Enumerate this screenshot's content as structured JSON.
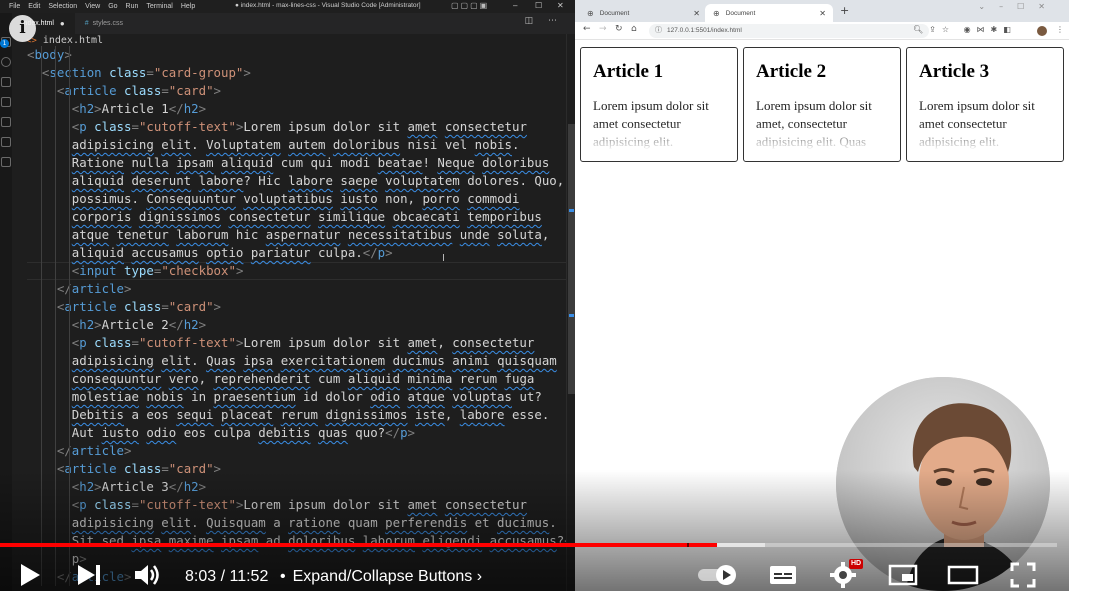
{
  "vscode": {
    "menu": [
      "File",
      "Edit",
      "Selection",
      "View",
      "Go",
      "Run",
      "Terminal",
      "Help"
    ],
    "window_title": "● index.html - max-lines-css - Visual Studio Code [Administrator]",
    "tabs": [
      {
        "label": "index.html",
        "modified": "●"
      },
      {
        "label": "styles.css",
        "icon": "#"
      }
    ],
    "breadcrumb": {
      "icon": "<>",
      "file": "index.html"
    },
    "badge": "1",
    "code_lines": [
      [
        "<body>"
      ],
      [
        "  <section class=\"card-group\">"
      ],
      [
        "    <article class=\"card\">"
      ],
      [
        "      <h2>Article 1</h2>"
      ],
      [
        "      <p class=\"cutoff-text\">Lorem ipsum dolor sit amet consectetur"
      ],
      [
        "      adipisicing elit. Voluptatem autem doloribus nisi vel nobis."
      ],
      [
        "      Ratione nulla ipsam aliquid cum qui modi beatae! Neque doloribus"
      ],
      [
        "      aliquid deserunt labore? Hic labore saepe voluptatem dolores. Quo,"
      ],
      [
        "      possimus. Consequuntur voluptatibus iusto non, porro commodi"
      ],
      [
        "      corporis dignissimos consectetur similique obcaecati temporibus"
      ],
      [
        "      atque tenetur laborum hic aspernatur necessitatibus unde soluta,"
      ],
      [
        "      aliquid accusamus optio pariatur culpa.</p>"
      ],
      [
        "      <input type=\"checkbox\">"
      ],
      [
        "    </article>"
      ],
      [
        "    <article class=\"card\">"
      ],
      [
        "      <h2>Article 2</h2>"
      ],
      [
        "      <p class=\"cutoff-text\">Lorem ipsum dolor sit amet, consectetur"
      ],
      [
        "      adipisicing elit. Quas ipsa exercitationem ducimus animi quisquam"
      ],
      [
        "      consequuntur vero, reprehenderit cum aliquid minima rerum fuga"
      ],
      [
        "      molestiae nobis in praesentium id dolor odio atque voluptas ut?"
      ],
      [
        "      Debitis a eos sequi placeat rerum dignissimos iste, labore esse."
      ],
      [
        "      Aut iusto odio eos culpa debitis quas quo?</p>"
      ],
      [
        "    </article>"
      ],
      [
        "    <article class=\"card\">"
      ],
      [
        "      <h2>Article 3</h2>"
      ],
      [
        "      <p class=\"cutoff-text\">Lorem ipsum dolor sit amet consectetur"
      ],
      [
        "      adipisicing elit. Quisquam a ratione quam perferendis et ducimus."
      ],
      [
        "      Sit sed ipsa maxime ipsam ad doloribus laborum eligendi accusamus?</"
      ],
      [
        "      p>"
      ],
      [
        "    </article>"
      ]
    ]
  },
  "browser": {
    "tabs": [
      {
        "label": "Document"
      },
      {
        "label": "Document"
      }
    ],
    "new_tab": "+",
    "url": "127.0.0.1:5501/index.html",
    "cards": [
      {
        "title": "Article 1",
        "text": "Lorem ipsum dolor sit amet consectetur adipisicing elit. Voluptatem autem"
      },
      {
        "title": "Article 2",
        "text": "Lorem ipsum dolor sit amet, consectetur adipisicing elit. Quas ipsa"
      },
      {
        "title": "Article 3",
        "text": "Lorem ipsum dolor sit amet consectetur adipisicing elit. Quisquam"
      }
    ]
  },
  "player": {
    "current_time": "8:03",
    "duration": "11:52",
    "time_separator": " / ",
    "chapter_bullet": "•",
    "chapter": "Expand/Collapse Buttons",
    "hd_badge": "HD",
    "progress_played": 0.678,
    "progress_buffered": 0.724,
    "accent_color": "#ff0000",
    "icons": [
      "info-icon",
      "play-icon",
      "next-icon",
      "volume-icon",
      "chapter-chevron-icon",
      "autoplay-toggle-icon",
      "subtitles-icon",
      "settings-icon",
      "miniplayer-icon",
      "theater-icon",
      "fullscreen-icon"
    ]
  }
}
